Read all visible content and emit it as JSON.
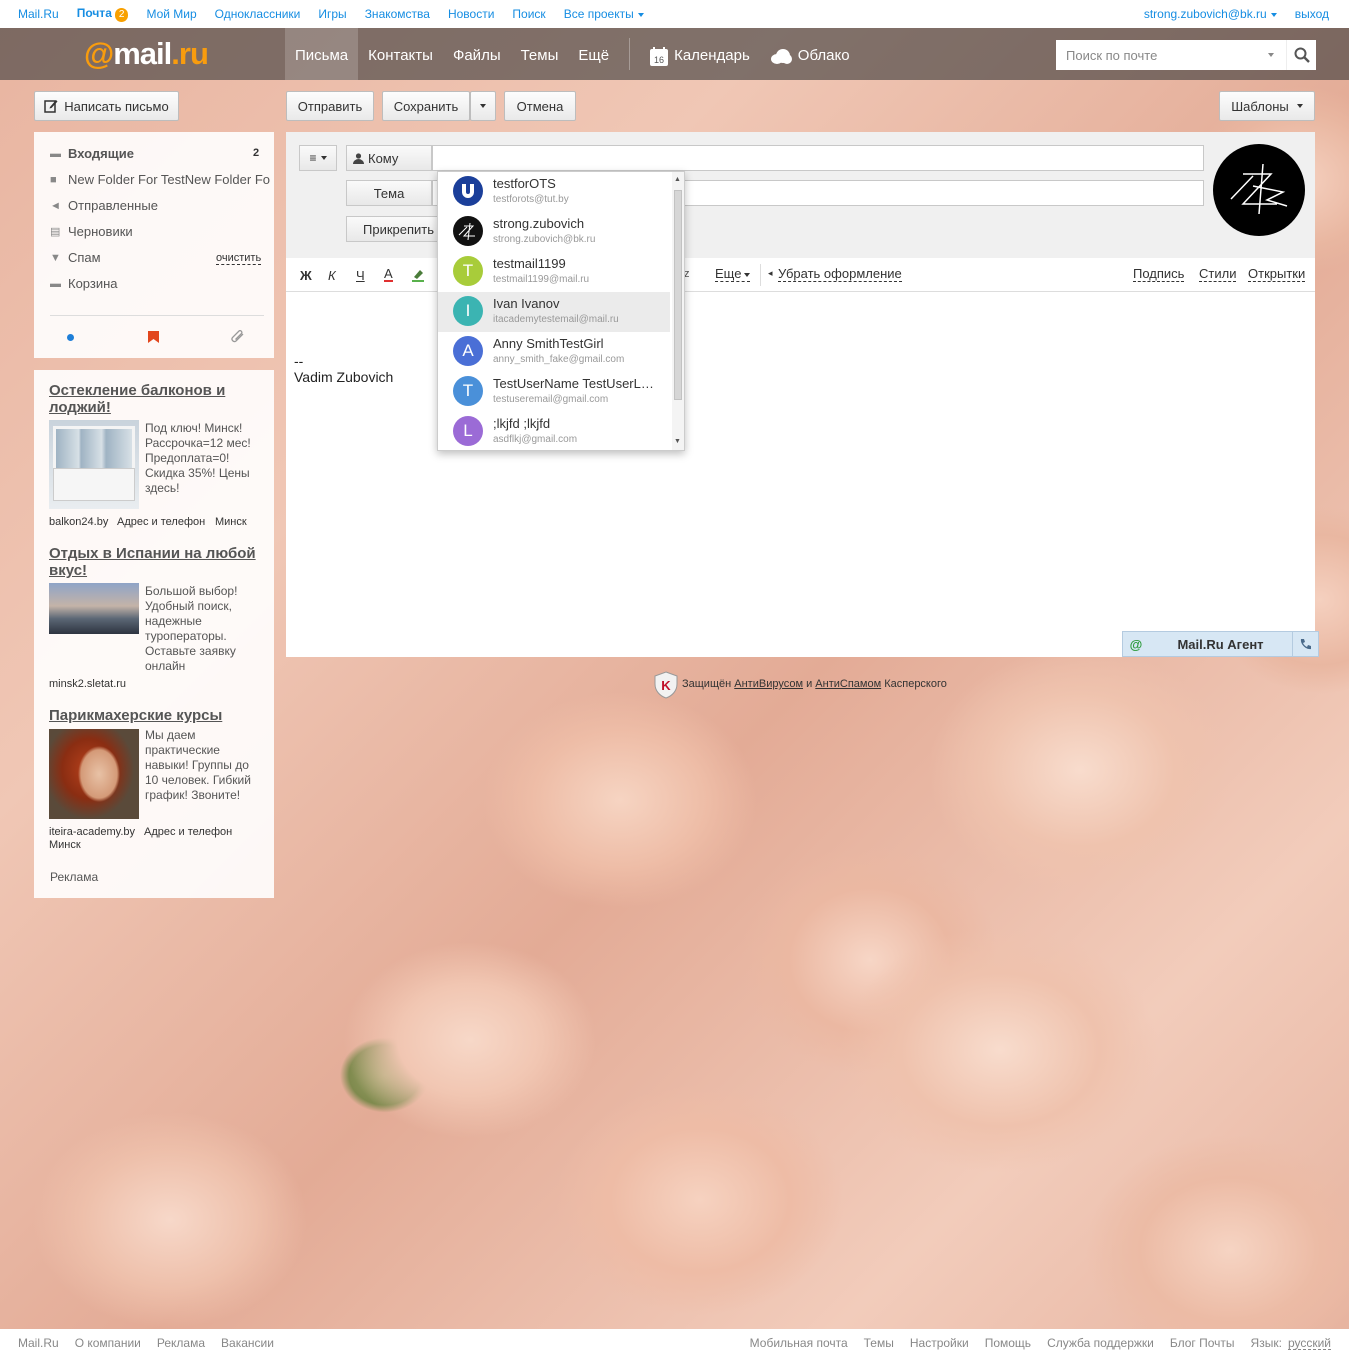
{
  "portal": {
    "links": [
      "Mail.Ru",
      "Почта",
      "Мой Мир",
      "Одноклассники",
      "Игры",
      "Знакомства",
      "Новости",
      "Поиск",
      "Все проекты"
    ],
    "mail_badge": "2",
    "user": "strong.zubovich@bk.ru",
    "logout": "выход"
  },
  "header": {
    "logo": "@mail.ru",
    "nav": [
      "Письма",
      "Контакты",
      "Файлы",
      "Темы",
      "Ещё"
    ],
    "calendar": "Календарь",
    "calendar_day": "16",
    "cloud": "Облако",
    "search_placeholder": "Поиск по почте"
  },
  "actions": {
    "compose": "Написать письмо",
    "send": "Отправить",
    "save": "Сохранить",
    "cancel": "Отмена",
    "templates": "Шаблоны"
  },
  "folders": [
    {
      "label": "Входящие",
      "count": "2",
      "icon": "inbox-icon"
    },
    {
      "label": "New Folder For TestNew Folder Fo",
      "icon": "folder-icon"
    },
    {
      "label": "Отправленные",
      "icon": "sent-icon"
    },
    {
      "label": "Черновики",
      "icon": "drafts-icon"
    },
    {
      "label": "Спам",
      "action": "очистить",
      "icon": "spam-icon"
    },
    {
      "label": "Корзина",
      "icon": "trash-icon"
    }
  ],
  "ads": [
    {
      "title": "Остекление балконов и лоджий!",
      "text": "Под ключ! Минск! Рассрочка=12 мес! Предоплата=0! Скидка 35%! Цены здесь!",
      "meta": [
        "balkon24.by",
        "Адрес и телефон",
        "Минск"
      ]
    },
    {
      "title": "Отдых в Испании на любой вкус!",
      "text": "Большой выбор! Удобный поиск, надежные туроператоры. Оставьте заявку онлайн",
      "meta": [
        "minsk2.sletat.ru"
      ]
    },
    {
      "title": "Парикмахерские курсы",
      "text": "Мы даем практические навыки! Группы до 10 человек. Гибкий график! Звоните!",
      "meta": [
        "iteira-academy.by",
        "Адрес и телефон",
        "Минск"
      ]
    }
  ],
  "ads_label": "Реклама",
  "compose": {
    "to_label": "Кому",
    "subject_label": "Тема",
    "attach_label": "Прикрепить",
    "toolbar": {
      "bold": "Ж",
      "italic": "К",
      "underline": "Ч",
      "color": "A",
      "more": "Еще",
      "clear": "Убрать оформление",
      "signature": "Подпись",
      "styles": "Стили",
      "cards": "Открытки"
    },
    "body_sig_dash": "--",
    "body_sig_name": "Vadim Zubovich"
  },
  "suggestions": [
    {
      "name": "testforOTS",
      "email": "testforots@tut.by",
      "color": "#1b3f9a",
      "letter": "U"
    },
    {
      "name": "strong.zubovich",
      "email": "strong.zubovich@bk.ru",
      "color": "#111111",
      "letter": ""
    },
    {
      "name": "testmail1199",
      "email": "testmail1199@mail.ru",
      "color": "#a8cc3a",
      "letter": "T"
    },
    {
      "name": "Ivan Ivanov",
      "email": "itacademytestemail@mail.ru",
      "color": "#3bb4b2",
      "letter": "I"
    },
    {
      "name": "Anny SmithTestGirl",
      "email": "anny_smith_fake@gmail.com",
      "color": "#4a6fd6",
      "letter": "A"
    },
    {
      "name": "TestUserName TestUserLastName",
      "email": "testuseremail@gmail.com",
      "color": "#4a90d9",
      "letter": "T"
    },
    {
      "name": ";lkjfd ;lkjfd",
      "email": "asdflkj@gmail.com",
      "color": "#9b6bd6",
      "letter": "L"
    }
  ],
  "protection": {
    "prefix": "Защищён",
    "av": "АнтиВирусом",
    "and": "и",
    "as": "АнтиСпамом",
    "suffix": "Касперского"
  },
  "agent": "Mail.Ru Агент",
  "footer": {
    "left": [
      "Mail.Ru",
      "О компании",
      "Реклама",
      "Вакансии"
    ],
    "right": [
      "Мобильная почта",
      "Темы",
      "Настройки",
      "Помощь",
      "Служба поддержки",
      "Блог Почты"
    ],
    "lang_label": "Язык:",
    "lang": "русский"
  }
}
